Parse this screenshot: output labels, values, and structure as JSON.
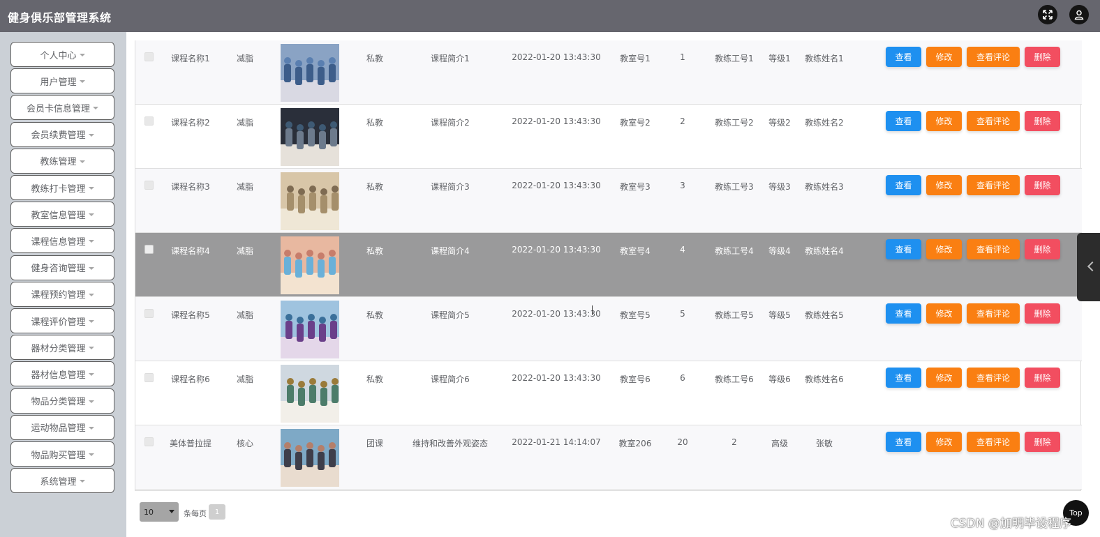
{
  "app": {
    "title": "健身俱乐部管理系统"
  },
  "sidebar": {
    "items": [
      {
        "label": "个人中心"
      },
      {
        "label": "用户管理"
      },
      {
        "label": "会员卡信息管理"
      },
      {
        "label": "会员续费管理"
      },
      {
        "label": "教练管理"
      },
      {
        "label": "教练打卡管理"
      },
      {
        "label": "教室信息管理"
      },
      {
        "label": "课程信息管理"
      },
      {
        "label": "健身咨询管理"
      },
      {
        "label": "课程预约管理"
      },
      {
        "label": "课程评价管理"
      },
      {
        "label": "器材分类管理"
      },
      {
        "label": "器材信息管理"
      },
      {
        "label": "物品分类管理"
      },
      {
        "label": "运动物品管理"
      },
      {
        "label": "物品购买管理"
      },
      {
        "label": "系统管理"
      }
    ]
  },
  "table": {
    "actions": {
      "view": "查看",
      "edit": "修改",
      "review": "查看评论",
      "delete": "删除"
    },
    "rows": [
      {
        "name": "课程名称1",
        "type": "减脂",
        "category": "私教",
        "intro": "课程简介1",
        "time": "2022-01-20 13:43:30",
        "room": "教室号1",
        "count": "1",
        "coach_no": "教练工号1",
        "level": "等级1",
        "coach_name": "教练姓名1"
      },
      {
        "name": "课程名称2",
        "type": "减脂",
        "category": "私教",
        "intro": "课程简介2",
        "time": "2022-01-20 13:43:30",
        "room": "教室号2",
        "count": "2",
        "coach_no": "教练工号2",
        "level": "等级2",
        "coach_name": "教练姓名2"
      },
      {
        "name": "课程名称3",
        "type": "减脂",
        "category": "私教",
        "intro": "课程简介3",
        "time": "2022-01-20 13:43:30",
        "room": "教室号3",
        "count": "3",
        "coach_no": "教练工号3",
        "level": "等级3",
        "coach_name": "教练姓名3"
      },
      {
        "name": "课程名称4",
        "type": "减脂",
        "category": "私教",
        "intro": "课程简介4",
        "time": "2022-01-20 13:43:30",
        "room": "教室号4",
        "count": "4",
        "coach_no": "教练工号4",
        "level": "等级4",
        "coach_name": "教练姓名4"
      },
      {
        "name": "课程名称5",
        "type": "减脂",
        "category": "私教",
        "intro": "课程简介5",
        "time": "2022-01-20 13:43:30",
        "room": "教室号5",
        "count": "5",
        "coach_no": "教练工号5",
        "level": "等级5",
        "coach_name": "教练姓名5"
      },
      {
        "name": "课程名称6",
        "type": "减脂",
        "category": "私教",
        "intro": "课程简介6",
        "time": "2022-01-20 13:43:30",
        "room": "教室号6",
        "count": "6",
        "coach_no": "教练工号6",
        "level": "等级6",
        "coach_name": "教练姓名6"
      },
      {
        "name": "美体普拉提",
        "type": "核心",
        "category": "团课",
        "intro": "维持和改善外观姿态",
        "time": "2022-01-21 14:14:07",
        "room": "教室206",
        "count": "20",
        "coach_no": "2",
        "level": "高级",
        "coach_name": "张敏"
      }
    ]
  },
  "pager": {
    "page_size": "10",
    "per_page_label": "条每页",
    "current_page": "1"
  },
  "top_button": {
    "label": "Top"
  },
  "watermark": {
    "text": "CSDN @加明毕设程序"
  },
  "colors": {
    "topbar": "#66666e",
    "sidebar": "#cbd0d6",
    "view": "#1e90f0",
    "edit": "#fa7f12",
    "delete": "#f24e60",
    "hover_row": "#9a9a9b"
  }
}
